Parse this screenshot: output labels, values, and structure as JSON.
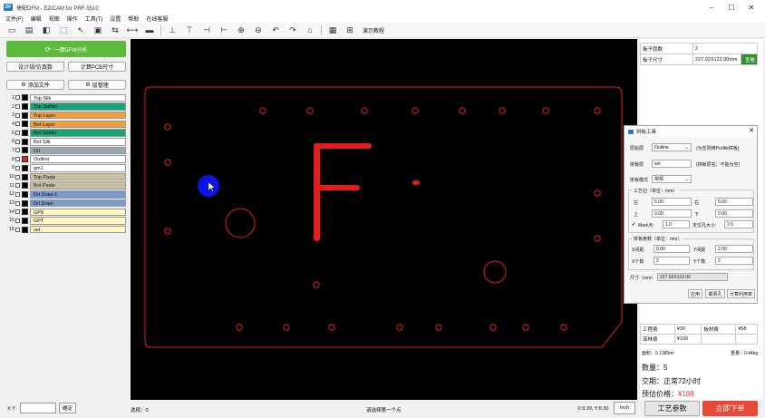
{
  "window": {
    "title": "捷配DFM - EZ/CAM for PRF-5510",
    "app_icon": "DF"
  },
  "menu": [
    "文件(F)",
    "编辑",
    "视图",
    "操作",
    "工具(T)",
    "设置",
    "帮助",
    "在线客服"
  ],
  "toolbar": {
    "demo_label": "演示教程"
  },
  "left": {
    "dfm_button": "一键DFM分析",
    "design_spec_button": "设计规/仿真数",
    "calc_size_button": "计算PCB尺寸",
    "add_file_button": "添加文件",
    "layer_manage_button": "层管理",
    "layers": [
      {
        "num": "1",
        "name": "Top Silk",
        "color": "#ffffff",
        "swatch": "#000000"
      },
      {
        "num": "2",
        "name": "Top Solder",
        "color": "#1aa37a",
        "swatch": "#000000"
      },
      {
        "num": "3",
        "name": "Top Layer",
        "color": "#f0a040",
        "swatch": "#000000"
      },
      {
        "num": "4",
        "name": "Bot Layer",
        "color": "#f0a040",
        "swatch": "#000000"
      },
      {
        "num": "5",
        "name": "Bot Solder",
        "color": "#1aa37a",
        "swatch": "#000000"
      },
      {
        "num": "6",
        "name": "Bot Silk",
        "color": "#ffffff",
        "swatch": "#000000"
      },
      {
        "num": "7",
        "name": "Drl",
        "color": "#9aa8b0",
        "swatch": "#000000"
      },
      {
        "num": "8",
        "name": "Outline",
        "color": "#ffffff",
        "swatch": "#e02020"
      },
      {
        "num": "9",
        "name": "gm1",
        "color": "#ffffff",
        "swatch": "#000000"
      },
      {
        "num": "10",
        "name": "Top Paste",
        "color": "#c8c0a0",
        "swatch": "#000000"
      },
      {
        "num": "11",
        "name": "Bot Paste",
        "color": "#c8c0a0",
        "swatch": "#000000"
      },
      {
        "num": "12",
        "name": "Drl Draw-1",
        "color": "#7a9ad0",
        "swatch": "#000000"
      },
      {
        "num": "13",
        "name": "Drl Draw",
        "color": "#7a9ad0",
        "swatch": "#000000"
      },
      {
        "num": "14",
        "name": "GP8",
        "color": "#fff8c0",
        "swatch": "#000000"
      },
      {
        "num": "15",
        "name": "GPT",
        "color": "#fff8c0",
        "swatch": "#000000"
      },
      {
        "num": "16",
        "name": "set",
        "color": "#fff8c0",
        "swatch": "#000000"
      }
    ]
  },
  "right": {
    "board_layers_label": "板子层数",
    "board_layers_value": "2",
    "board_size_label": "板子尺寸",
    "board_size_value": "227.02X122.00mm",
    "view_button": "查看",
    "cost_label": "工程费",
    "cost_value": "¥30",
    "board_fee_label": "板材费",
    "board_fee_value": "¥58",
    "film_label": "菲林费",
    "film_value": "¥100",
    "area_text": "面积：0.1385m²",
    "weight_text": "重量：0.44kg",
    "quantity_text": "数量：5",
    "delivery_text": "交期：正常72小时",
    "price_label": "预估价格：",
    "price_value": "¥188"
  },
  "dialog": {
    "title": "拼板工具",
    "source_layer_label": "原始层",
    "source_layer_value": "Outline",
    "source_layer_hint": "(为空则用Profile拼板)",
    "panel_layer_label": "拼板层",
    "panel_layer_value": "set",
    "panel_layer_hint": "(拼板层名，不能为空)",
    "panel_mode_label": "拼板模式",
    "panel_mode_value": "常规",
    "margin_group": "工艺边（单位：mm）",
    "left_label": "左",
    "left_value": "5.00",
    "right_label": "右",
    "right_value": "5.00",
    "top_label": "上",
    "top_value": "0.00",
    "bottom_label": "下",
    "bottom_value": "0.00",
    "mark_label": "Mark点:",
    "mark_value": "1.0",
    "hole_label": "定位孔大小:",
    "hole_value": "2.0",
    "params_group": "拼板参数（单位：mm）",
    "xgap_label": "X间距",
    "xgap_value": "0.00",
    "ygap_label": "Y间距",
    "ygap_value": "2.00",
    "xcount_label": "X个数",
    "xcount_value": "2",
    "ycount_label": "Y个数",
    "ycount_value": "2",
    "size_label": "尺寸（mm）",
    "size_value": "227.02X122.00",
    "apply_button": "应用",
    "stamp_button": "邮票孔",
    "calc_button": "计算利用率"
  },
  "status": {
    "xy_label": "X Y:",
    "confirm_button": "确定",
    "selection_text": "选择：0",
    "hint_text": "请选择第一个点",
    "coords_text": "X:8.39, Y:8.30",
    "unit_button": "Inch",
    "process_button": "工艺参数",
    "order_button": "立即下单"
  }
}
